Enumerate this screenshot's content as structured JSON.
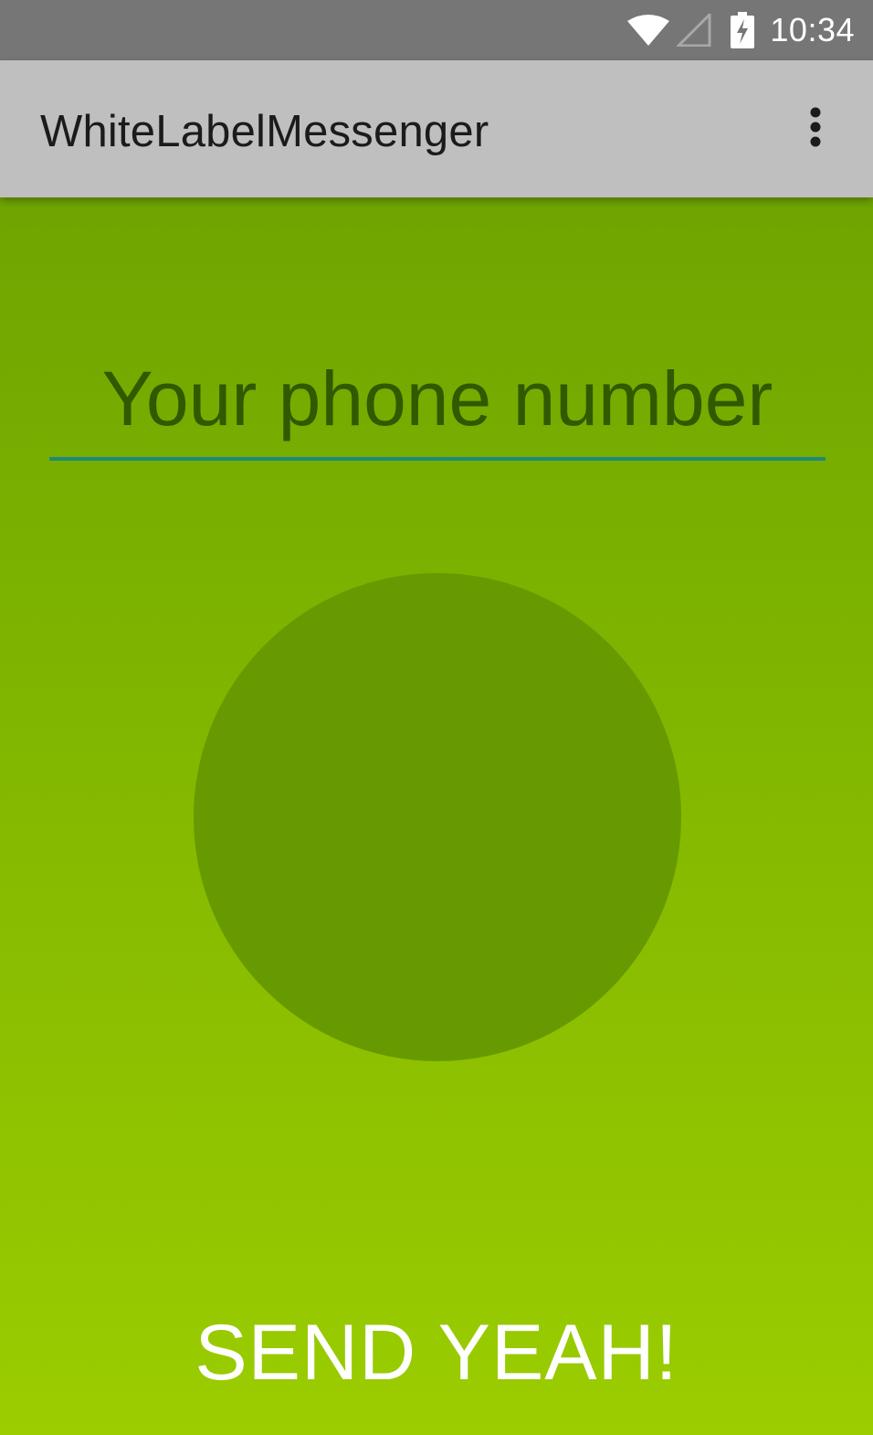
{
  "status_bar": {
    "time": "10:34",
    "icons": [
      "wifi-icon",
      "cell-signal-icon",
      "battery-charging-icon"
    ]
  },
  "app_bar": {
    "title": "WhiteLabelMessenger",
    "menu_icon": "more-vert-icon"
  },
  "main": {
    "phone_input": {
      "placeholder": "Your phone number",
      "value": ""
    },
    "send_label": "SEND YEAH!"
  },
  "colors": {
    "status_bar_bg": "#767676",
    "app_bar_bg": "#bfbfbf",
    "background_top": "#689d00",
    "background_bottom": "#9bcd00",
    "circle": "#669a00",
    "input_underline": "#1e8a78",
    "placeholder_text": "#2f5a00",
    "send_text": "#ffffff"
  }
}
